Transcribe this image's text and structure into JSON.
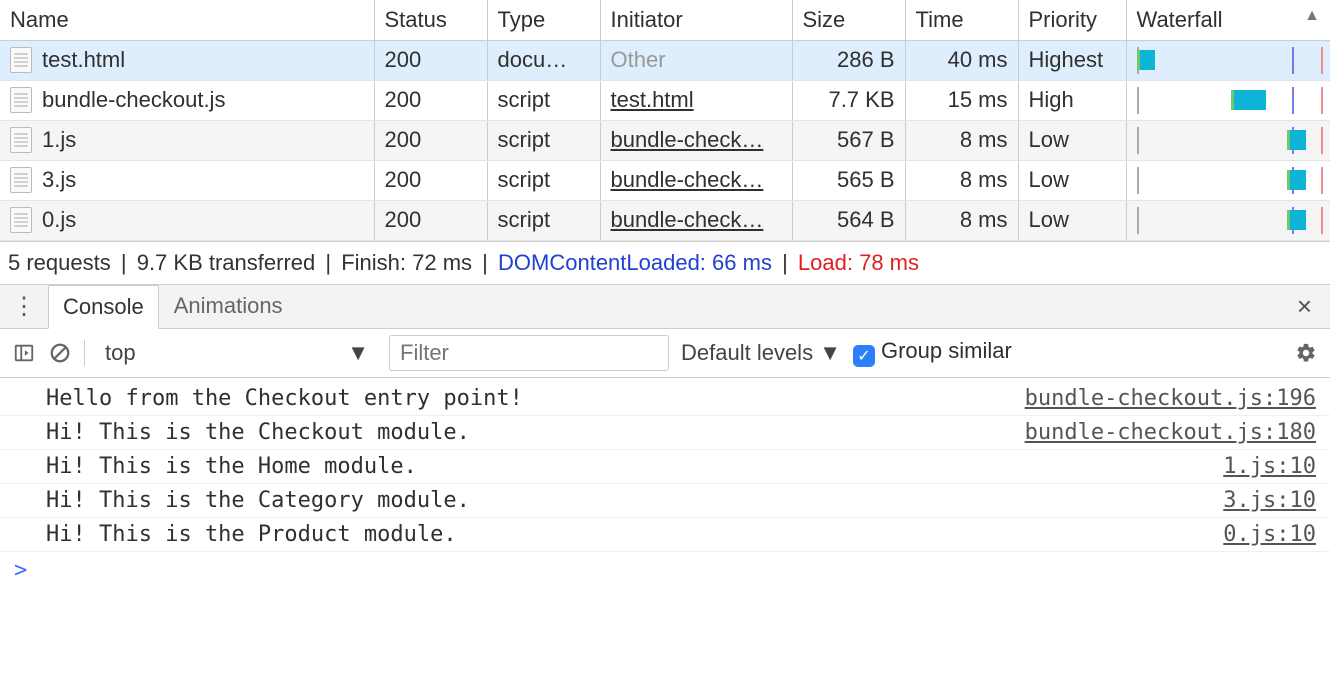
{
  "network": {
    "headers": {
      "name": "Name",
      "status": "Status",
      "type": "Type",
      "initiator": "Initiator",
      "size": "Size",
      "time": "Time",
      "priority": "Priority",
      "waterfall": "Waterfall"
    },
    "sort_arrow": "▲",
    "timeline": {
      "max_ms": 78,
      "dcl_ms": 66,
      "load_ms": 78
    },
    "rows": [
      {
        "name": "test.html",
        "status": "200",
        "type": "docu…",
        "initiator": "Other",
        "initiator_kind": "other",
        "size": "286 B",
        "time": "40 ms",
        "priority": "Highest",
        "wf_start": 0,
        "wf_dur": 8,
        "selected": true,
        "stripe": false
      },
      {
        "name": "bundle-checkout.js",
        "status": "200",
        "type": "script",
        "initiator": "test.html",
        "initiator_kind": "link",
        "size": "7.7 KB",
        "time": "15 ms",
        "priority": "High",
        "wf_start": 40,
        "wf_dur": 15,
        "selected": false,
        "stripe": false
      },
      {
        "name": "1.js",
        "status": "200",
        "type": "script",
        "initiator": "bundle-check…",
        "initiator_kind": "link",
        "size": "567 B",
        "time": "8 ms",
        "priority": "Low",
        "wf_start": 64,
        "wf_dur": 8,
        "selected": false,
        "stripe": true
      },
      {
        "name": "3.js",
        "status": "200",
        "type": "script",
        "initiator": "bundle-check…",
        "initiator_kind": "link",
        "size": "565 B",
        "time": "8 ms",
        "priority": "Low",
        "wf_start": 64,
        "wf_dur": 8,
        "selected": false,
        "stripe": false
      },
      {
        "name": "0.js",
        "status": "200",
        "type": "script",
        "initiator": "bundle-check…",
        "initiator_kind": "link",
        "size": "564 B",
        "time": "8 ms",
        "priority": "Low",
        "wf_start": 64,
        "wf_dur": 8,
        "selected": false,
        "stripe": true
      }
    ],
    "summary": {
      "requests": "5 requests",
      "transferred": "9.7 KB transferred",
      "finish": "Finish: 72 ms",
      "dcl": "DOMContentLoaded: 66 ms",
      "load": "Load: 78 ms"
    }
  },
  "drawer": {
    "tabs": {
      "console": "Console",
      "animations": "Animations"
    },
    "close": "×"
  },
  "console_toolbar": {
    "context": "top",
    "context_arrow": "▼",
    "filter_placeholder": "Filter",
    "levels_label": "Default levels",
    "levels_arrow": "▼",
    "group_label": "Group similar"
  },
  "console": {
    "prompt": ">",
    "messages": [
      {
        "text": "Hello from the Checkout entry point!",
        "source": "bundle-checkout.js:196"
      },
      {
        "text": "Hi! This is the Checkout module.",
        "source": "bundle-checkout.js:180"
      },
      {
        "text": "Hi! This is the Home module.",
        "source": "1.js:10"
      },
      {
        "text": "Hi! This is the Category module.",
        "source": "3.js:10"
      },
      {
        "text": "Hi! This is the Product module.",
        "source": "0.js:10"
      }
    ]
  }
}
